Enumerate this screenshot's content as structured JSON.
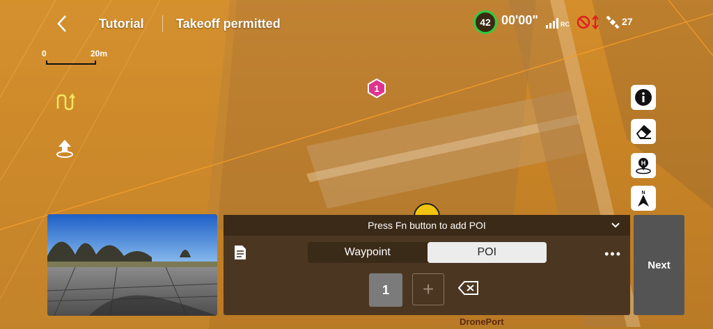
{
  "topbar": {
    "back_label": "<",
    "mission_name": "Tutorial",
    "flight_status": "Takeoff permitted",
    "battery_percent": "42",
    "flight_time": "00'00\"",
    "rc_label": "RC",
    "satellite_count": "27",
    "colors": {
      "battery_ring": "#2ecc40",
      "motor_warning": "#e02020"
    }
  },
  "scale": {
    "start": "0",
    "end": "20m"
  },
  "map": {
    "poi_number": "1",
    "place_label": "DronePort",
    "colors": {
      "overlay": "#d48e2c",
      "route_line": "#f0a040",
      "poi": "#e0338f"
    }
  },
  "tools": {
    "info": "info-icon",
    "erase": "eraser-icon",
    "home": "home-point-icon",
    "compass": "N"
  },
  "panel": {
    "hint": "Press Fn button to add POI",
    "tabs": [
      "Waypoint",
      "POI"
    ],
    "active_tab": "POI",
    "more": "•••",
    "selected_index": "1",
    "add": "+"
  },
  "next_label": "Next"
}
